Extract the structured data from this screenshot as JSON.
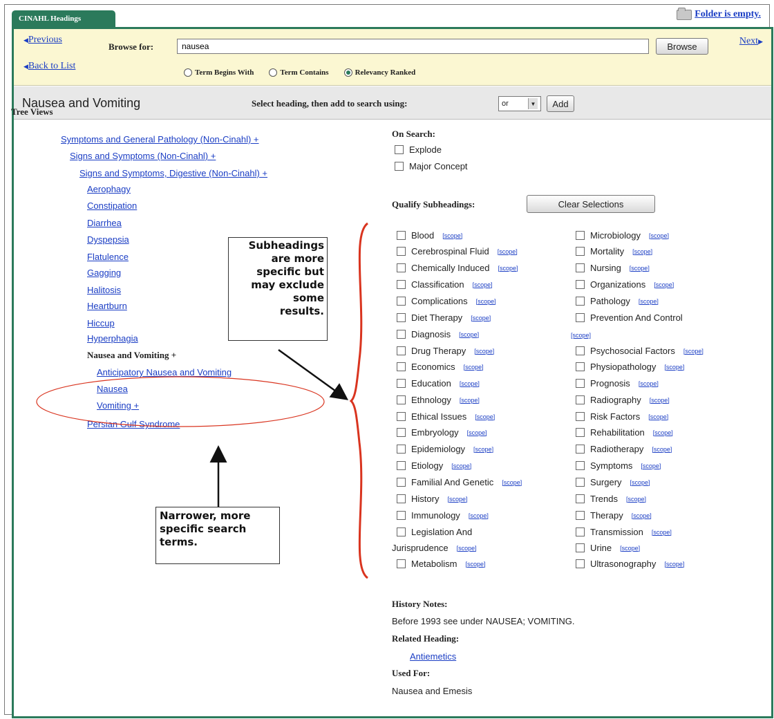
{
  "tab": {
    "label": "CINAHL Headings"
  },
  "folder": {
    "text": "Folder is empty."
  },
  "browse_bar": {
    "previous_label": "Previous",
    "back_label": "Back to List",
    "next_label": "Next",
    "browse_for_label": "Browse for:",
    "search_value": "nausea",
    "browse_button_label": "Browse",
    "radio_options": [
      {
        "label": "Term Begins With",
        "selected": false
      },
      {
        "label": "Term Contains",
        "selected": false
      },
      {
        "label": "Relevancy Ranked",
        "selected": true
      }
    ]
  },
  "heading_bar": {
    "title": "Nausea and Vomiting",
    "select_label": "Select heading, then add to search using:",
    "combine_value": "or",
    "add_label": "Add"
  },
  "tree": {
    "title": "Tree Views",
    "items": [
      {
        "label": "Symptoms and General Pathology (Non-Cinahl) +",
        "link": true
      },
      {
        "label": "Signs and Symptoms (Non-Cinahl) +",
        "link": true
      },
      {
        "label": "Signs and Symptoms, Digestive (Non-Cinahl) +",
        "link": true
      },
      {
        "label": "Aerophagy",
        "link": true
      },
      {
        "label": "Constipation",
        "link": true
      },
      {
        "label": "Diarrhea",
        "link": true
      },
      {
        "label": "Dyspepsia",
        "link": true
      },
      {
        "label": "Flatulence",
        "link": true
      },
      {
        "label": "Gagging",
        "link": true
      },
      {
        "label": "Halitosis",
        "link": true
      },
      {
        "label": "Heartburn",
        "link": true
      },
      {
        "label": "Hiccup",
        "link": true
      },
      {
        "label": "Hyperphagia",
        "link": true
      },
      {
        "label": "Nausea and Vomiting +",
        "link": false
      },
      {
        "label": "Anticipatory Nausea and Vomiting",
        "link": true
      },
      {
        "label": "Nausea",
        "link": true
      },
      {
        "label": "Vomiting +",
        "link": true
      },
      {
        "label": "Persian Gulf Syndrome",
        "link": true
      }
    ]
  },
  "on_search": {
    "label": "On Search:",
    "options": [
      "Explode",
      "Major Concept"
    ]
  },
  "qualify": {
    "label": "Qualify Subheadings:",
    "clear_label": "Clear Selections",
    "scope_label": "[scope]",
    "left": [
      "Blood",
      "Cerebrospinal Fluid",
      "Chemically Induced",
      "Classification",
      "Complications",
      "Diet Therapy",
      "Diagnosis",
      "Drug Therapy",
      "Economics",
      "Education",
      "Ethnology",
      "Ethical Issues",
      "Embryology",
      "Epidemiology",
      "Etiology",
      "Familial And Genetic",
      "History",
      "Immunology",
      "Legislation And",
      "Metabolism"
    ],
    "left_wrap": "Jurisprudence",
    "right": [
      "Microbiology",
      "Mortality",
      "Nursing",
      "Organizations",
      "Pathology",
      "Prevention And Control",
      "Psychosocial Factors",
      "Physiopathology",
      "Prognosis",
      "Radiography",
      "Risk Factors",
      "Rehabilitation",
      "Radiotherapy",
      "Symptoms",
      "Surgery",
      "Trends",
      "Therapy",
      "Transmission",
      "Urine",
      "Ultrasonography"
    ]
  },
  "notes": {
    "history_label": "History Notes:",
    "history_text": "Before 1993 see under NAUSEA; VOMITING.",
    "related_label": "Related Heading:",
    "related_link": "Antiemetics",
    "used_for_label": "Used For:",
    "used_for_text": "Nausea and Emesis"
  },
  "callouts": {
    "subheadings_lines": [
      "Subheadings",
      "are more",
      "specific but",
      "may exclude",
      "some",
      "results."
    ],
    "narrower_lines": [
      "Narrower, more",
      "specific search",
      "terms."
    ]
  },
  "colors": {
    "brand_green": "#2b7a5b",
    "annotation_red": "#d9341f",
    "link_blue": "#1a3dc4",
    "browse_bg": "#fbf7d2"
  }
}
